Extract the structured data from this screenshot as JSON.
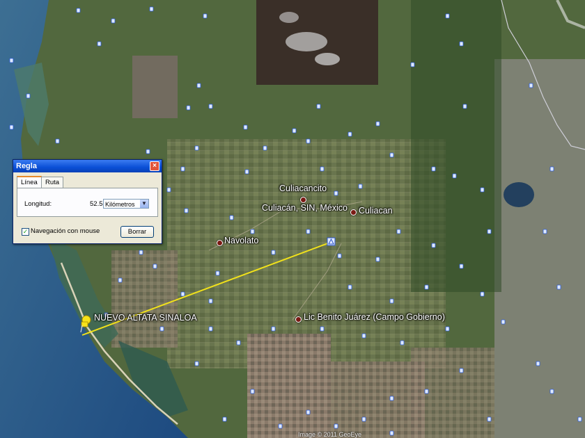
{
  "map": {
    "places": [
      {
        "id": "culiacancito",
        "label": "Culiacancito"
      },
      {
        "id": "culiacan-sin",
        "label": "Culiacán, SIN, México"
      },
      {
        "id": "culiacan",
        "label": "Culiacan"
      },
      {
        "id": "navolato",
        "label": "Navolato"
      },
      {
        "id": "altata",
        "label": "NUEVO ALTATA SINALOA"
      },
      {
        "id": "benito",
        "label": "Lic Benito Juárez (Campo Gobierno)"
      }
    ],
    "copyright": "Image © 2011 GeoEye",
    "colors": {
      "ruler_line": "#f2e21a",
      "ocean": "#2a5a8c",
      "land": "#556a3e"
    }
  },
  "ruler_dialog": {
    "title": "Regla",
    "close_icon": "close-icon",
    "tabs": [
      {
        "label": "Línea",
        "active": true
      },
      {
        "label": "Ruta",
        "active": false
      }
    ],
    "length_label": "Longitud:",
    "length_value": "52.55",
    "unit_selected": "Kilómetros",
    "mouse_nav_label": "Navegación con mouse",
    "mouse_nav_checked": true,
    "clear_button": "Borrar"
  }
}
